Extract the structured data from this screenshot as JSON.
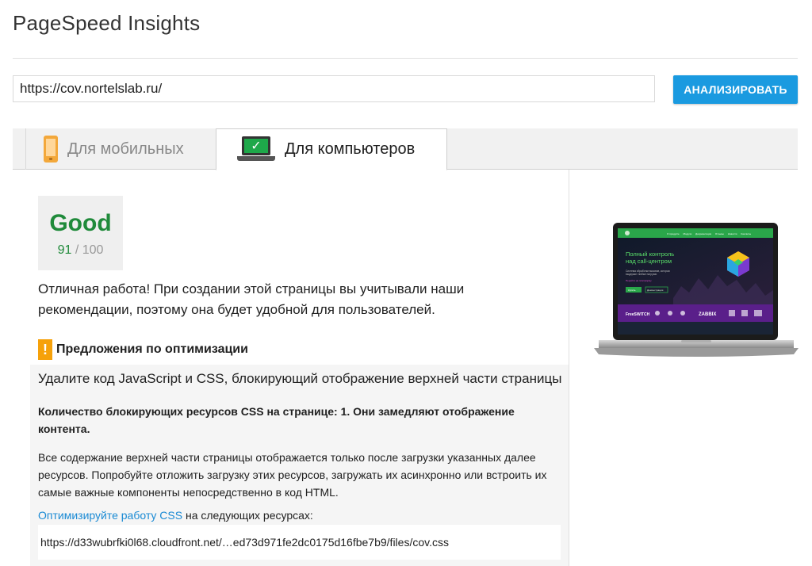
{
  "app": {
    "title": "PageSpeed Insights"
  },
  "search": {
    "url_value": "https://cov.nortelslab.ru/",
    "analyze_label": "АНАЛИЗИРОВАТЬ"
  },
  "tabs": [
    {
      "label": "Для мобильных",
      "icon": "phone-icon",
      "active": false
    },
    {
      "label": "Для компьютеров",
      "icon": "laptop-icon",
      "active": true
    }
  ],
  "score": {
    "label": "Good",
    "value": "91",
    "max": "/ 100",
    "color": "#1f8a3a"
  },
  "summary": "Отличная работа! При создании этой страницы вы учитывали наши рекомендации, поэтому она будет удобной для пользователей.",
  "suggestions": {
    "header_icon": "!",
    "header": "Предложения по оптимизации",
    "items": [
      {
        "title": "Удалите код JavaScript и CSS, блокирующий отображение верхней части страницы",
        "bold": "Количество блокирующих ресурсов CSS на странице: 1. Они замедляют отображение контента.",
        "description": "Все содержание верхней части страницы отображается только после загрузки указанных далее ресурсов. Попробуйте отложить загрузку этих ресурсов, загружать их асинхронно или встроить их самые важные компоненты непосредственно в код HTML.",
        "link_text": "Оптимизируйте работу CSS",
        "link_suffix": " на следующих ресурсах:",
        "resource": "https://d33wubrfki0l68.cloudfront.net/…ed73d971fe2dc0175d16fbe7b9/files/cov.css"
      }
    ]
  },
  "preview": {
    "nav_items": [
      "О продукте",
      "Модули",
      "Документация",
      "Отзывы",
      "Новости",
      "Контакты"
    ],
    "hero_line1": "Полный контроль",
    "hero_line2": "над call-центром",
    "subtitle_line1": "Система обработки вызовов, которая",
    "subtitle_line2": "выдержит любые нагрузки",
    "tagline": "Перейти на платформу",
    "btn_primary": "Купить",
    "btn_secondary": "Демонстрация",
    "logo_brand": "FreeSWITCH",
    "logo_zabbix": "ZABBIX"
  },
  "colors": {
    "accent": "#1a9ae0",
    "good": "#1f8a3a",
    "warning": "#f6a10a",
    "link": "#1a8ad4"
  }
}
